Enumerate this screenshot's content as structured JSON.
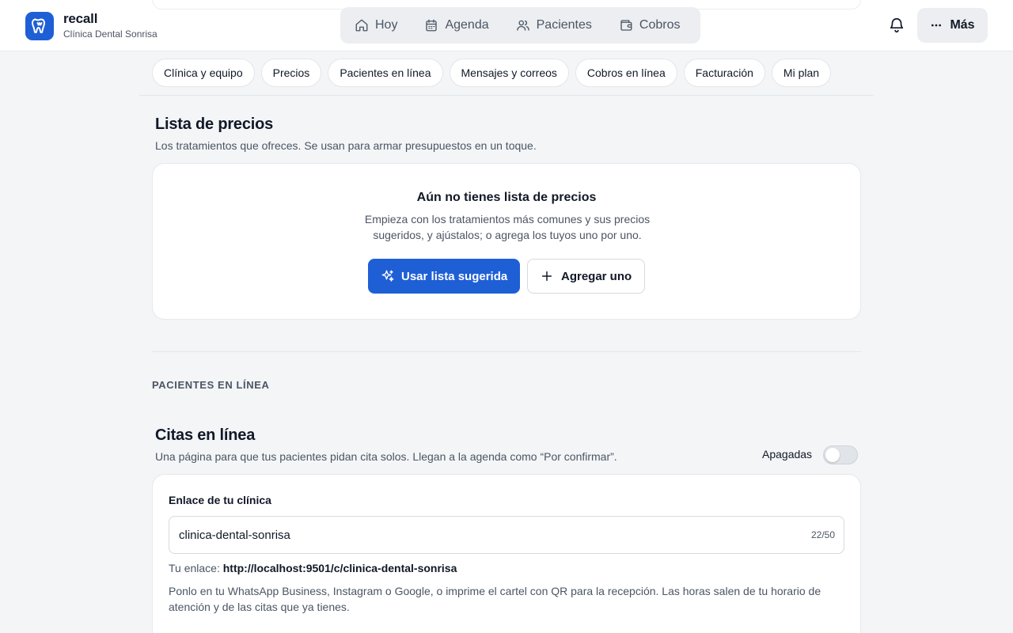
{
  "brand": {
    "name": "recall",
    "clinic": "Clínica Dental Sonrisa",
    "accent": "#1f5fd6"
  },
  "nav": {
    "items": [
      {
        "label": "Hoy",
        "icon": "home-icon"
      },
      {
        "label": "Agenda",
        "icon": "calendar-icon"
      },
      {
        "label": "Pacientes",
        "icon": "users-icon"
      },
      {
        "label": "Cobros",
        "icon": "wallet-icon"
      }
    ],
    "more_label": "Más"
  },
  "subtabs": [
    "Clínica y equipo",
    "Precios",
    "Pacientes en línea",
    "Mensajes y correos",
    "Cobros en línea",
    "Facturación",
    "Mi plan"
  ],
  "prices": {
    "title": "Lista de precios",
    "subtitle": "Los tratamientos que ofreces. Se usan para armar presupuestos en un toque.",
    "empty_title": "Aún no tienes lista de precios",
    "empty_desc": "Empieza con los tratamientos más comunes y sus precios sugeridos, y ajústalos; o agrega los tuyos uno por uno.",
    "primary_label": "Usar lista sugerida",
    "secondary_label": "Agregar uno"
  },
  "online_section": {
    "label": "PACIENTES EN LÍNEA"
  },
  "booking": {
    "title": "Citas en línea",
    "subtitle": "Una página para que tus pacientes pidan cita solos. Llegan a la agenda como “Por confirmar”.",
    "toggle_label": "Apagadas",
    "toggle_on": false,
    "field_label": "Enlace de tu clínica",
    "slug_value": "clinica-dental-sonrisa",
    "counter": "22/50",
    "link_prefix": "Tu enlace:",
    "link_url": "http://localhost:9501/c/clinica-dental-sonrisa",
    "help": "Ponlo en tu WhatsApp Business, Instagram o Google, o imprime el cartel con QR para la recepción. Las horas salen de tu horario de atención y de las citas que ya tienes."
  }
}
